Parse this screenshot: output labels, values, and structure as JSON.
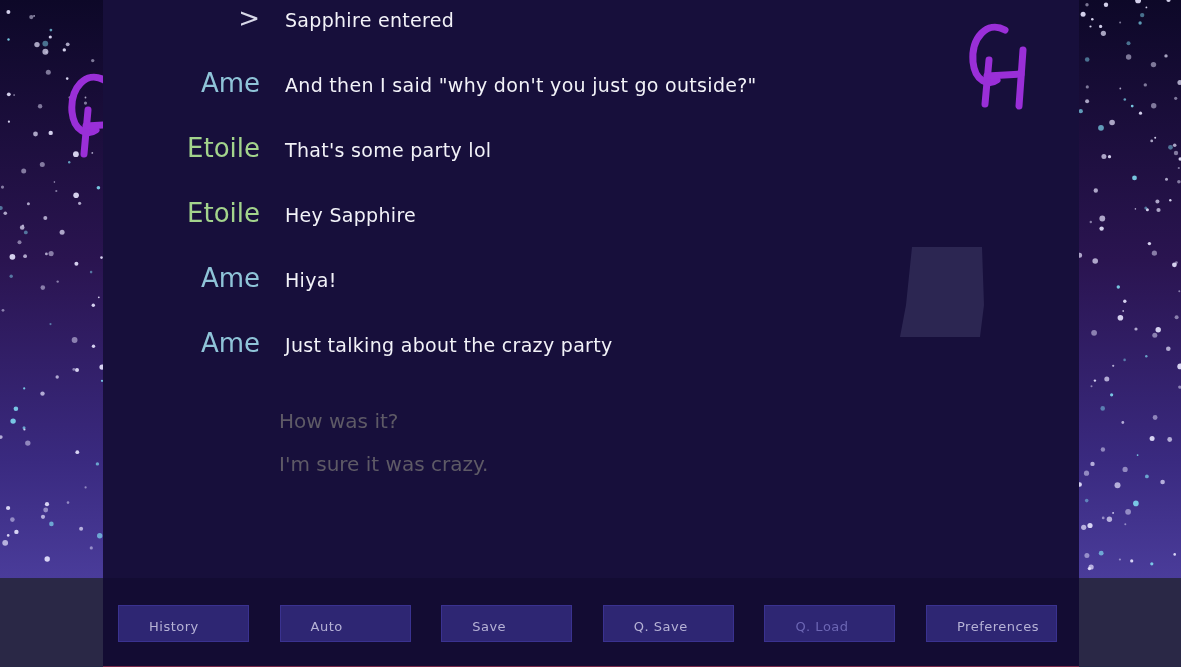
{
  "history": [
    {
      "speaker": ">",
      "color": "#d8d8e8",
      "text": "Sapphire entered"
    },
    {
      "speaker": "Ame",
      "color": "#8fc4d8",
      "text": "And then I said \"why don't you just go outside?\""
    },
    {
      "speaker": "Etoile",
      "color": "#a3d48c",
      "text": "That's some party lol"
    },
    {
      "speaker": "Etoile",
      "color": "#a3d48c",
      "text": "Hey Sapphire"
    },
    {
      "speaker": "Ame",
      "color": "#8fc4d8",
      "text": "Hiya!"
    },
    {
      "speaker": "Ame",
      "color": "#8fc4d8",
      "text": "Just talking about the crazy party"
    }
  ],
  "choices": [
    {
      "label": "How was it?"
    },
    {
      "label": "I'm sure it was crazy."
    }
  ],
  "quick_menu": [
    {
      "label": "History",
      "disabled": false
    },
    {
      "label": "Auto",
      "disabled": false
    },
    {
      "label": "Save",
      "disabled": false
    },
    {
      "label": "Q. Save",
      "disabled": false
    },
    {
      "label": "Q. Load",
      "disabled": true
    },
    {
      "label": "Preferences",
      "disabled": false
    }
  ]
}
